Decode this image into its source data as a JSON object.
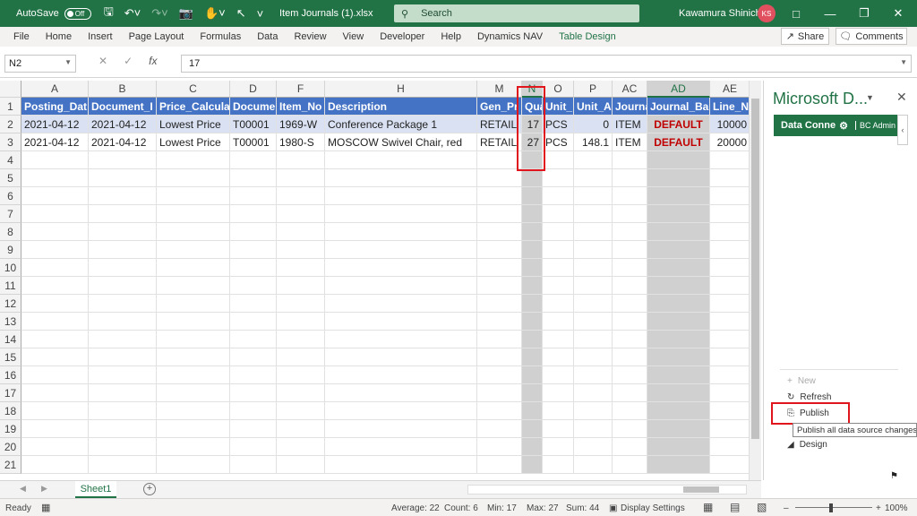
{
  "titlebar": {
    "autosave_label": "AutoSave",
    "autosave_state": "Off",
    "filename": "Item Journals (1).xlsx",
    "search_placeholder": "Search",
    "user_name": "Kawamura Shinichi",
    "user_initials": "KS",
    "bg_color": "#217346"
  },
  "menu": {
    "items": [
      "File",
      "Home",
      "Insert",
      "Page Layout",
      "Formulas",
      "Data",
      "Review",
      "View",
      "Developer",
      "Help",
      "Dynamics NAV",
      "Table Design"
    ],
    "share": "Share",
    "comments": "Comments"
  },
  "formula_bar": {
    "name_box": "N2",
    "fx": "fx",
    "value": "17"
  },
  "sheet": {
    "columns": [
      "A",
      "B",
      "C",
      "D",
      "F",
      "H",
      "M",
      "N",
      "O",
      "P",
      "AC",
      "AD",
      "AE"
    ],
    "selected_columns": [
      "N",
      "AD"
    ],
    "rows": [
      "1",
      "2",
      "3",
      "4",
      "5",
      "6",
      "7",
      "8",
      "9",
      "10",
      "11",
      "12",
      "13",
      "14",
      "15",
      "16",
      "17",
      "18",
      "19",
      "20",
      "21"
    ],
    "header_row": [
      "Posting_Dat",
      "Document_I",
      "Price_Calcula",
      "Docume",
      "Item_No",
      "Description",
      "Gen_Pr",
      "Qua",
      "Unit_",
      "Unit_A",
      "Journa",
      "Journal_Ba",
      "Line_N"
    ],
    "data_rows": [
      [
        "2021-04-12",
        "2021-04-12",
        "Lowest Price",
        "T00001",
        "1969-W",
        "Conference Package 1",
        "RETAIL",
        "17",
        "PCS",
        "0",
        "ITEM",
        "DEFAULT",
        "10000"
      ],
      [
        "2021-04-12",
        "2021-04-12",
        "Lowest Price",
        "T00001",
        "1980-S",
        "MOSCOW Swivel Chair, red",
        "RETAIL",
        "27",
        "PCS",
        "148.1",
        "ITEM",
        "DEFAULT",
        "20000"
      ]
    ],
    "table_header_color": "#4472c4",
    "band_color": "#d9e1f2",
    "highlight_color": "#c00000"
  },
  "tabs": {
    "sheet_name": "Sheet1"
  },
  "status": {
    "ready": "Ready",
    "average": "Average: 22",
    "count": "Count: 6",
    "min": "Min: 17",
    "max": "Max: 27",
    "sum": "Sum: 44",
    "display_settings": "Display Settings",
    "zoom": "100%"
  },
  "panel": {
    "title": "Microsoft D...",
    "tab_label": "Data Conne",
    "user": "BC Admin",
    "actions": {
      "new": "New",
      "refresh": "Refresh",
      "publish": "Publish",
      "design": "Design"
    },
    "tooltip": "Publish all data source changes"
  }
}
